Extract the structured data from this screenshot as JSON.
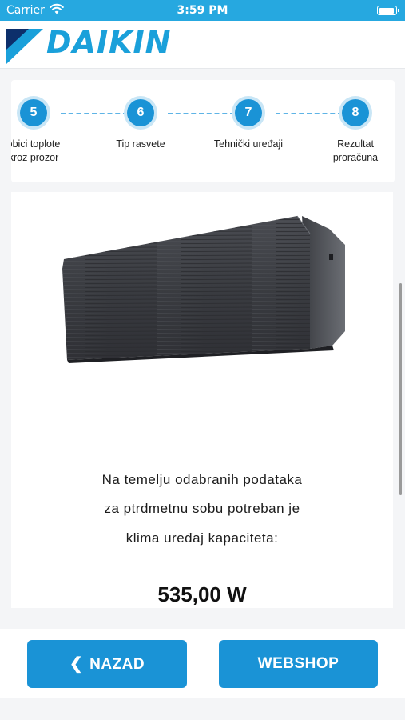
{
  "status_bar": {
    "carrier": "Carrier",
    "time": "3:59 PM",
    "battery_level": 0.95
  },
  "header": {
    "logo_text": "DAIKIN",
    "logo_icon": "daikin-logo-mark"
  },
  "steps": [
    {
      "number": "5",
      "label_line1": "obici toplote",
      "label_line2": "kroz prozor"
    },
    {
      "number": "6",
      "label_line1": "Tip rasvete",
      "label_line2": ""
    },
    {
      "number": "7",
      "label_line1": "Tehnički uređaji",
      "label_line2": ""
    },
    {
      "number": "8",
      "label_line1": "Rezultat",
      "label_line2": "proračuna"
    }
  ],
  "product": {
    "image_icon": "air-conditioner-unit",
    "text_line1": "Na temelju odabranih podataka",
    "text_line2": "za ptrdmetnu sobu potreban je",
    "text_line3": "klima uređaj kapaciteta:",
    "result_value": "535,00 W"
  },
  "actions": {
    "back_icon": "chevron-left-icon",
    "back_label": "NAZAD",
    "shop_label": "WEBSHOP"
  },
  "colors": {
    "accent": "#1a93d6",
    "status_bar": "#26a8e0",
    "brand": "#1aa0da"
  }
}
